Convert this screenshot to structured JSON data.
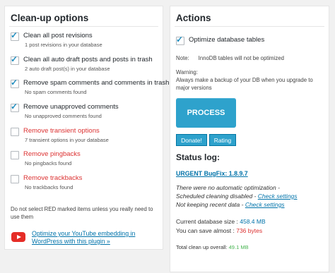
{
  "left": {
    "title": "Clean-up options",
    "options": [
      {
        "label": "Clean all post revisions",
        "sub": "1 post revisions in your database",
        "checked": true,
        "red": false
      },
      {
        "label": "Clean all auto draft posts and posts in trash",
        "sub": "2 auto draft post(s) in your database",
        "checked": true,
        "red": false
      },
      {
        "label": "Remove spam comments and comments in trash",
        "sub": "No spam comments found",
        "checked": true,
        "red": false
      },
      {
        "label": "Remove unapproved comments",
        "sub": "No unapproved comments found",
        "checked": true,
        "red": false
      },
      {
        "label": "Remove transient options",
        "sub": "7 transient options in your database",
        "checked": false,
        "red": true
      },
      {
        "label": "Remove pingbacks",
        "sub": "No pingbacks found",
        "checked": false,
        "red": true
      },
      {
        "label": "Remove trackbacks",
        "sub": "No trackbacks found",
        "checked": false,
        "red": true
      }
    ],
    "warning": "Do not select RED marked items unless you really need to use them",
    "youtube_link": "Optimize your YouTube embedding in WordPress with this plugin »"
  },
  "right": {
    "title": "Actions",
    "optimize_label": "Optimize database tables",
    "optimize_checked": true,
    "note": "Note:      InnoDB tables will not be optimized",
    "warning_title": "Warning:",
    "warning_text": "Always make a backup of your DB when you upgrade to major versions",
    "process_label": "PROCESS",
    "donate_label": "Donate!",
    "rating_label": "Rating",
    "status_title": "Status log:",
    "urgent_link": "URGENT BugFix: 1.8.9.7",
    "log_line1": "There were no automatic optimization -",
    "log_line2_text": "Scheduled cleaning disabled - ",
    "log_line3_text": "Not keeping recent data - ",
    "check_settings": "Check settings",
    "db_size_label": "Current database size : ",
    "db_size_value": "458.4 MB",
    "save_label": "You can save almost : ",
    "save_value": "736 bytes",
    "total_label": "Total clean up overall: ",
    "total_value": "49.1 MB"
  }
}
